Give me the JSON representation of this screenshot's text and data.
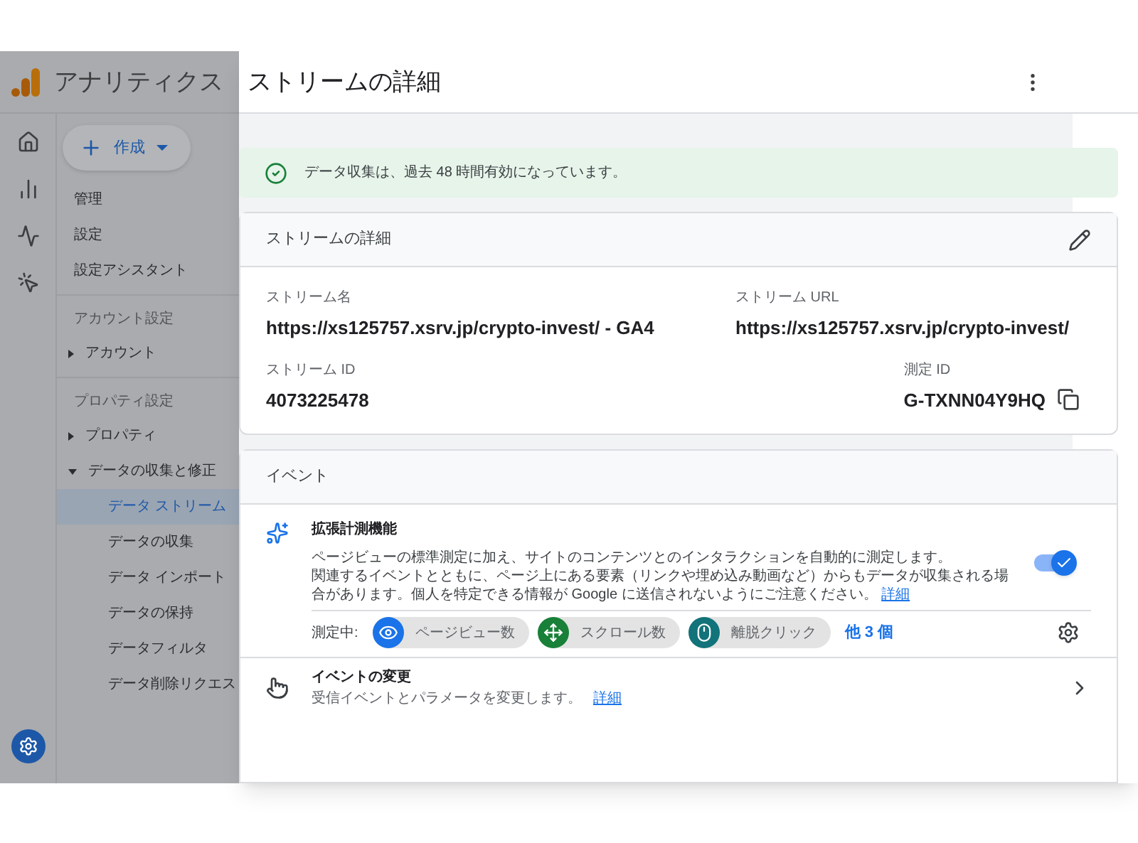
{
  "app": {
    "title": "アナリティクス",
    "create_button": "作成"
  },
  "nav_sections": [
    {
      "items": [
        {
          "kind": "link",
          "label": "管理"
        },
        {
          "kind": "link",
          "label": "設定"
        },
        {
          "kind": "link",
          "label": "設定アシスタント"
        }
      ]
    },
    {
      "heading": "アカウント設定",
      "items": [
        {
          "kind": "group",
          "label": "アカウント",
          "expanded": false
        }
      ]
    },
    {
      "heading": "プロパティ設定",
      "items": [
        {
          "kind": "group",
          "label": "プロパティ",
          "expanded": false
        },
        {
          "kind": "group",
          "label": "データの収集と修正",
          "expanded": true,
          "children": [
            {
              "label": "データ ストリーム",
              "selected": true
            },
            {
              "label": "データの収集",
              "selected": false
            },
            {
              "label": "データ インポート",
              "selected": false
            },
            {
              "label": "データの保持",
              "selected": false
            },
            {
              "label": "データフィルタ",
              "selected": false
            },
            {
              "label": "データ削除リクエス",
              "selected": false
            }
          ]
        }
      ]
    }
  ],
  "panel": {
    "title": "ストリームの詳細",
    "banner": "データ収集は、過去 48 時間有効になっています。",
    "details": {
      "title": "ストリームの詳細",
      "fields": [
        {
          "label": "ストリーム名",
          "value": "https://xs125757.xsrv.jp/crypto-invest/ - GA4",
          "copy": false
        },
        {
          "label": "ストリーム URL",
          "value": "https://xs125757.xsrv.jp/crypto-invest/",
          "copy": false
        },
        {
          "label": "ストリーム ID",
          "value": "4073225478",
          "copy": false
        },
        {
          "label": "測定 ID",
          "value": "G-TXNN04Y9HQ",
          "copy": true
        }
      ]
    },
    "events": {
      "title": "イベント",
      "enhanced": {
        "title": "拡張計測機能",
        "paragraphs": [
          "ページビューの標準測定に加え、サイトのコンテンツとのインタラクションを自動的に測定します。",
          "関連するイベントとともに、ページ上にある要素（リンクや埋め込み動画など）からもデータが収集される場合があります。個人を特定できる情報が Google に送信されないようにご注意ください。"
        ],
        "link": "詳細",
        "on": true,
        "measuring_label": "測定中:",
        "chips": [
          {
            "kind": "eye",
            "label": "ページビュー数",
            "color": "#1a73e8"
          },
          {
            "kind": "scroll",
            "label": "スクロール数",
            "color": "#188038"
          },
          {
            "kind": "mouse",
            "label": "離脱クリック",
            "color": "#12737a"
          }
        ],
        "more": "他 3 個"
      },
      "modify": {
        "title": "イベントの変更",
        "description": "受信イベントとパラメータを変更します。",
        "link": "詳細"
      }
    }
  }
}
